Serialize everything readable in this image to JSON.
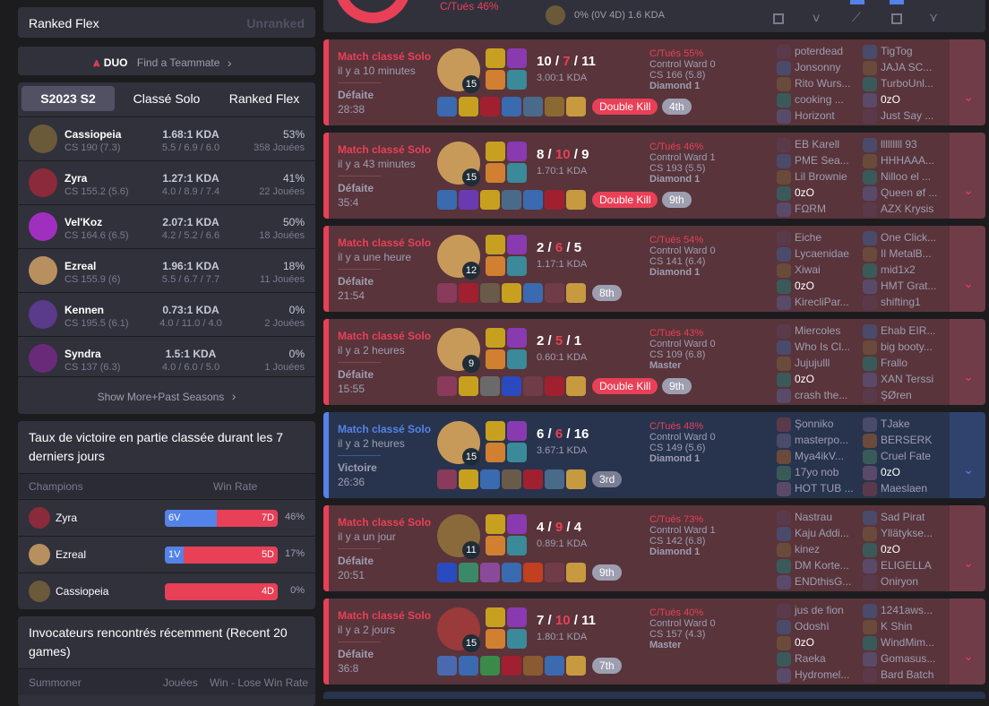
{
  "left": {
    "ranked_flex": {
      "title": "Ranked Flex",
      "status": "Unranked"
    },
    "duo": {
      "badge": "DUO",
      "label": "Find a Teammate"
    },
    "tabs": [
      "S2023 S2",
      "Classé Solo",
      "Ranked Flex"
    ],
    "champions": [
      {
        "name": "Cassiopeia",
        "cs": "CS 190 (7.3)",
        "kda": "1.68:1 KDA",
        "kda_detail": "5.5 / 6.9 / 6.0",
        "winrate": "53%",
        "played": "358 Jouées",
        "color": "#6b5a3a"
      },
      {
        "name": "Zyra",
        "cs": "CS 155.2 (5.6)",
        "kda": "1.27:1 KDA",
        "kda_detail": "4.0 / 8.9 / 7.4",
        "winrate": "41%",
        "played": "22 Jouées",
        "color": "#8a2a3a"
      },
      {
        "name": "Vel'Koz",
        "cs": "CS 164.6 (6.5)",
        "kda": "2.07:1 KDA",
        "kda_detail": "4.2 / 5.2 / 6.6",
        "winrate": "50%",
        "played": "18 Jouées",
        "color": "#a02fc0"
      },
      {
        "name": "Ezreal",
        "cs": "CS 155.9 (6)",
        "kda": "1.96:1 KDA",
        "kda_detail": "5.5 / 6.7 / 7.7",
        "winrate": "18%",
        "played": "11 Jouées",
        "color": "#b89060"
      },
      {
        "name": "Kennen",
        "cs": "CS 195.5 (6.1)",
        "kda": "0.73:1 KDA",
        "kda_detail": "4.0 / 11.0 / 4.0",
        "winrate": "0%",
        "played": "2 Jouées",
        "color": "#5a3a8a"
      },
      {
        "name": "Syndra",
        "cs": "CS 137 (6.3)",
        "kda": "1.5:1 KDA",
        "kda_detail": "4.0 / 6.0 / 5.0",
        "winrate": "0%",
        "played": "1 Jouées",
        "color": "#6a2a7a"
      }
    ],
    "show_more": "Show More+Past Seasons",
    "recent_wr": {
      "title": "Taux de victoire en partie classée durant les 7 derniers jours",
      "col_champions": "Champions",
      "col_winrate": "Win Rate",
      "rows": [
        {
          "name": "Zyra",
          "wins": "6V",
          "losses": "7D",
          "pct": "46%",
          "win_frac": 0.46,
          "color": "#8a2a3a"
        },
        {
          "name": "Ezreal",
          "wins": "1V",
          "losses": "5D",
          "pct": "17%",
          "win_frac": 0.17,
          "color": "#b89060"
        },
        {
          "name": "Cassiopeia",
          "wins": "",
          "losses": "4D",
          "pct": "0%",
          "win_frac": 0,
          "color": "#6b5a3a"
        }
      ]
    },
    "recent_summoners": {
      "title": "Invocateurs rencontrés récemment (Recent 20 games)",
      "col_summoner": "Summoner",
      "col_played": "Jouées",
      "col_wl": "Win - Lose Win Rate"
    }
  },
  "top": {
    "kp": "C/Tués 46%",
    "stats": "0% (0V 4D)",
    "kda": "1.6 KDA"
  },
  "games": [
    {
      "result": "loss",
      "queue": "Match classé Solo",
      "ago": "il y a 10 minutes",
      "outcome": "Défaite",
      "duration": "28:38",
      "champ_color": "#c89a5a",
      "level": "15",
      "kills": "10",
      "deaths": "7",
      "assists": "11",
      "ratio": "3.00:1 KDA",
      "multikill": "Double Kill",
      "place": "4th",
      "kp": "C/Tués 55%",
      "ward": "Control Ward 0",
      "cs": "CS 166 (5.8)",
      "rank": "Diamond 1",
      "items": [
        "#3a6ab0",
        "#c8a020",
        "#a02030",
        "#3a6ab0",
        "#4a6a8a",
        "#8a6a30",
        "#c89a40"
      ],
      "team1": [
        "poterdead",
        "Jonsonny",
        "Rito Wurs...",
        "cooking ...",
        "Horizont"
      ],
      "team2": [
        "TigTog",
        "JAJA SC...",
        "TurboUnl...",
        "0zO",
        "Just Say ..."
      ],
      "me_team": 2,
      "me_index": 3
    },
    {
      "result": "loss",
      "queue": "Match classé Solo",
      "ago": "il y a 43 minutes",
      "outcome": "Défaite",
      "duration": "35:4",
      "champ_color": "#c89a5a",
      "level": "15",
      "kills": "8",
      "deaths": "10",
      "assists": "9",
      "ratio": "1.70:1 KDA",
      "multikill": "Double Kill",
      "place": "9th",
      "kp": "C/Tués 46%",
      "ward": "Control Ward 1",
      "cs": "CS 193 (5.5)",
      "rank": "Diamond 1",
      "items": [
        "#3a6ab0",
        "#6a3ab0",
        "#c8a020",
        "#4a6a8a",
        "#3a6ab0",
        "#a02030",
        "#c89a40"
      ],
      "team1": [
        "EB Karell",
        "PME Sea...",
        "Lil Brownie",
        "0zO",
        "FΩRM"
      ],
      "team2": [
        "lllllllll 93",
        "HHHAAA...",
        "Nilloo el ...",
        "Queen øf ...",
        "AZX Krysis"
      ],
      "me_team": 1,
      "me_index": 3
    },
    {
      "result": "loss",
      "queue": "Match classé Solo",
      "ago": "il y a une heure",
      "outcome": "Défaite",
      "duration": "21:54",
      "champ_color": "#c89a5a",
      "level": "12",
      "kills": "2",
      "deaths": "6",
      "assists": "5",
      "ratio": "1.17:1 KDA",
      "multikill": "",
      "place": "8th",
      "kp": "C/Tués 54%",
      "ward": "Control Ward 0",
      "cs": "CS 141 (6.4)",
      "rank": "Diamond 1",
      "items": [
        "#8a3a5a",
        "#a02030",
        "#6a5a4a",
        "#c8a020",
        "#3a6ab0",
        "#703c47",
        "#c89a40"
      ],
      "team1": [
        "Eiche",
        "Lycaenidae",
        "Xiwai",
        "0zO",
        "KirecliPar..."
      ],
      "team2": [
        "One Click...",
        "Il MetalB...",
        "mid1x2",
        "HMT Grat...",
        "shifting1"
      ],
      "me_team": 1,
      "me_index": 3
    },
    {
      "result": "loss",
      "queue": "Match classé Solo",
      "ago": "il y a 2 heures",
      "outcome": "Défaite",
      "duration": "15:55",
      "champ_color": "#c89a5a",
      "level": "9",
      "kills": "2",
      "deaths": "5",
      "assists": "1",
      "ratio": "0.60:1 KDA",
      "multikill": "Double Kill",
      "place": "9th",
      "kp": "C/Tués 43%",
      "ward": "Control Ward 0",
      "cs": "CS 109 (6.8)",
      "rank": "Master",
      "items": [
        "#8a3a5a",
        "#c8a020",
        "#6a6a6a",
        "#2a4ac0",
        "#703c47",
        "#a02030",
        "#c89a40"
      ],
      "team1": [
        "Miercoles",
        "Who Is Cl...",
        "Jujujulll",
        "0zO",
        "crash the..."
      ],
      "team2": [
        "Ehab EIR...",
        "big booty...",
        "Frallo",
        "XAN Terssi",
        "ŞØren"
      ],
      "me_team": 1,
      "me_index": 3
    },
    {
      "result": "win",
      "queue": "Match classé Solo",
      "ago": "il y a 2 heures",
      "outcome": "Victoire",
      "duration": "26:36",
      "champ_color": "#c89a5a",
      "level": "15",
      "kills": "6",
      "deaths": "6",
      "assists": "16",
      "ratio": "3.67:1 KDA",
      "multikill": "",
      "place": "3rd",
      "kp": "C/Tués 48%",
      "ward": "Control Ward 0",
      "cs": "CS 149 (5.6)",
      "rank": "Diamond 1",
      "items": [
        "#8a3a5a",
        "#c8a020",
        "#3a6ab0",
        "#6a5a4a",
        "#a02030",
        "#4a6a8a",
        "#c89a40"
      ],
      "team1": [
        "Şonniko",
        "masterpo...",
        "Mya4ikV...",
        "17yo nob",
        "HOT TUB ..."
      ],
      "team2": [
        "TJake",
        "BERSERK",
        "Cruel Fate",
        "0zO",
        "Maeslaen"
      ],
      "me_team": 2,
      "me_index": 3
    },
    {
      "result": "loss",
      "queue": "Match classé Solo",
      "ago": "il y a un jour",
      "outcome": "Défaite",
      "duration": "20:51",
      "champ_color": "#8a6a3a",
      "level": "11",
      "kills": "4",
      "deaths": "9",
      "assists": "4",
      "ratio": "0.89:1 KDA",
      "multikill": "",
      "place": "9th",
      "kp": "C/Tués 73%",
      "ward": "Control Ward 1",
      "cs": "CS 142 (6.8)",
      "rank": "Diamond 1",
      "items": [
        "#2a4ac0",
        "#3a8a6a",
        "#8a4a9a",
        "#3a6ab0",
        "#c04020",
        "#703c47",
        "#c89a40"
      ],
      "team1": [
        "Nastrau",
        "Kaju Addi...",
        "kinez",
        "DM Korte...",
        "ENDthisG..."
      ],
      "team2": [
        "Sad Pirat",
        "Yllätykse...",
        "0zO",
        "ELIGELLA",
        "Oniryon"
      ],
      "me_team": 2,
      "me_index": 2
    },
    {
      "result": "loss",
      "queue": "Match classé Solo",
      "ago": "il y a 2 jours",
      "outcome": "Défaite",
      "duration": "36:8",
      "champ_color": "#9a3a3a",
      "level": "15",
      "kills": "7",
      "deaths": "10",
      "assists": "11",
      "ratio": "1.80:1 KDA",
      "multikill": "",
      "place": "7th",
      "kp": "C/Tués 40%",
      "ward": "Control Ward 0",
      "cs": "CS 157 (4.3)",
      "rank": "Master",
      "items": [
        "#4a6ab0",
        "#3a6ab0",
        "#3a8a4a",
        "#a02030",
        "#8a5a30",
        "#3a6ab0",
        "#c89a40"
      ],
      "team1": [
        "jus de fion",
        "Odoshì",
        "0zO",
        "Raeka",
        "Hydromel..."
      ],
      "team2": [
        "1241aws...",
        "K Shin",
        "WindMim...",
        "Gomasus...",
        "Bard Batch"
      ],
      "me_team": 1,
      "me_index": 2
    }
  ]
}
